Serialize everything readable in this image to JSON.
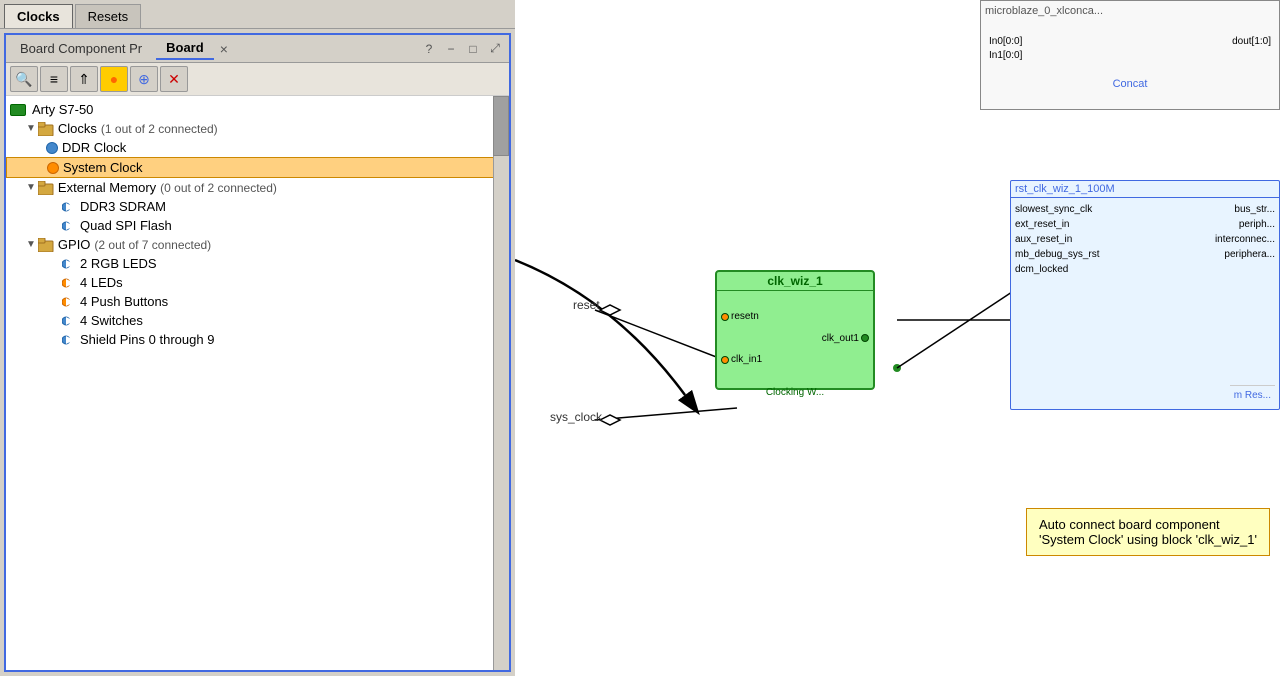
{
  "tabs": {
    "clocks": "Clocks",
    "resets": "Resets"
  },
  "panel": {
    "tab1": "Board Component Pr",
    "tab2": "Board",
    "close": "×",
    "icons": [
      "?",
      "−",
      "□",
      "⤢"
    ]
  },
  "toolbar": {
    "search": "🔍",
    "collapse": "≡",
    "expand": "⇑",
    "highlight": "●",
    "add": "⊕",
    "remove": "✕"
  },
  "tree": {
    "board": "Arty S7-50",
    "clocks": {
      "label": "Clocks",
      "status": "(1 out of 2 connected)",
      "children": [
        {
          "name": "DDR Clock",
          "type": "connected"
        },
        {
          "name": "System Clock",
          "type": "orange",
          "selected": true
        }
      ]
    },
    "external_memory": {
      "label": "External Memory",
      "status": "(0 out of 2 connected)",
      "children": [
        {
          "name": "DDR3 SDRAM"
        },
        {
          "name": "Quad SPI Flash"
        }
      ]
    },
    "gpio": {
      "label": "GPIO",
      "status": "(2 out of 7 connected)",
      "children": [
        {
          "name": "2 RGB LEDS"
        },
        {
          "name": "4 LEDs"
        },
        {
          "name": "4 Push Buttons"
        },
        {
          "name": "4 Switches"
        },
        {
          "name": "Shield Pins 0 through 9"
        }
      ]
    }
  },
  "diagram": {
    "clk_block": {
      "title": "clk_wiz_1",
      "ports_left": [
        "resetn",
        "clk_in1"
      ],
      "ports_right": [
        "clk_out1"
      ],
      "subtitle": "Clocking W..."
    },
    "rst_block": {
      "title": "rst_clk_wiz_1_100M",
      "ports_left": [
        "slowest_sync_clk",
        "ext_reset_in",
        "aux_reset_in",
        "mb_debug_sys_rst",
        "dcm_locked"
      ],
      "ports_right": [
        "bus_str...",
        "periph...",
        "interconnec...",
        "periphera..."
      ]
    },
    "concat_block": {
      "title": "Concat",
      "ports_left": [
        "In0[0:0]",
        "In1[0:0]"
      ],
      "ports_right": [
        "dout[1:0]"
      ]
    },
    "mb_block": {
      "title": "microblaze_0_xlconca..."
    },
    "labels": {
      "reset": "reset",
      "sys_clock": "sys_clock"
    },
    "tooltip": {
      "line1": "Auto connect board component",
      "line2": "'System Clock' using block 'clk_wiz_1'"
    }
  }
}
